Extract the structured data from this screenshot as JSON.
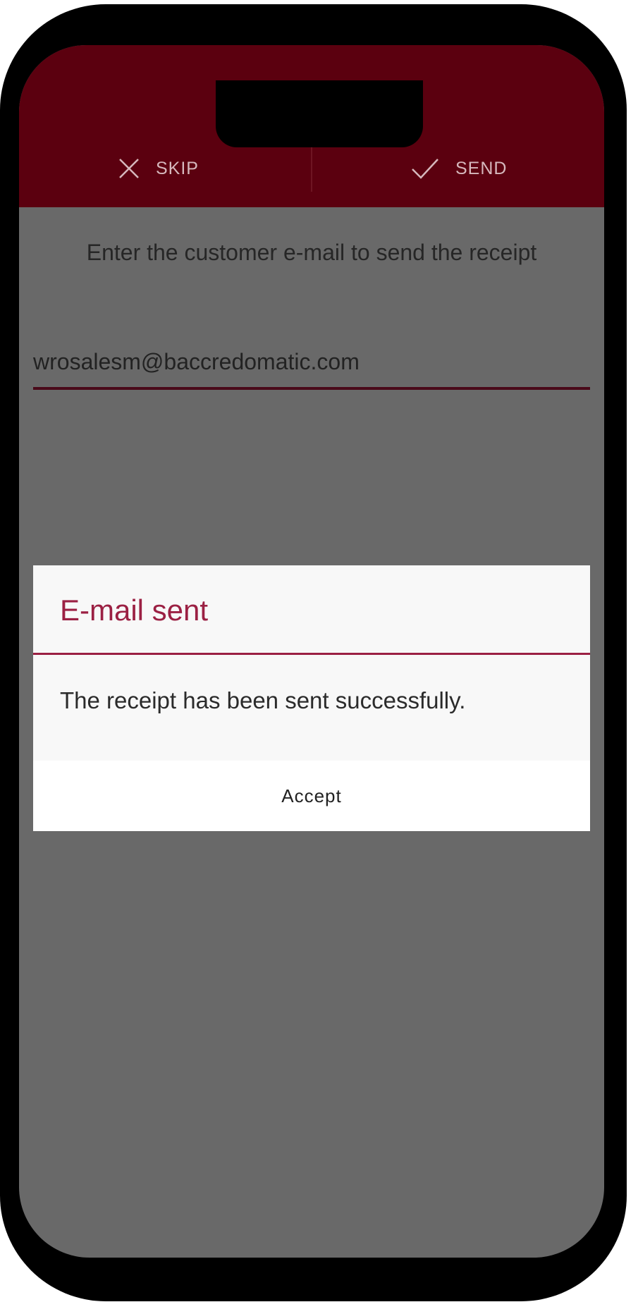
{
  "header": {
    "skip_label": "SKIP",
    "skip_icon": "close-icon",
    "send_label": "SEND",
    "send_icon": "check-icon"
  },
  "main": {
    "instruction": "Enter the customer e-mail to send the receipt",
    "email_value": "wrosalesm@baccredomatic.com"
  },
  "dialog": {
    "title": "E-mail sent",
    "message": "The receipt has been sent successfully.",
    "accept_label": "Accept"
  },
  "colors": {
    "header_bg": "#5b000f",
    "accent": "#9b2043",
    "overlay": "#696969"
  }
}
